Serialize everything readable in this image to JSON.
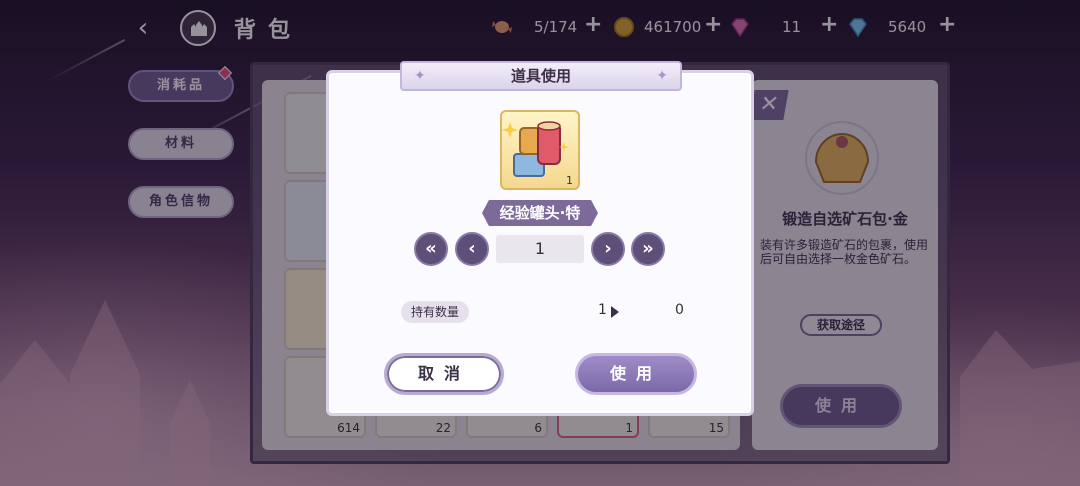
{
  "header": {
    "title": "背包",
    "resources": [
      {
        "icon": "candy-icon",
        "value": "5/174"
      },
      {
        "icon": "gold-coin-icon",
        "value": "461700"
      },
      {
        "icon": "pink-gem-icon",
        "value": "11"
      },
      {
        "icon": "blue-diamond-icon",
        "value": "5640"
      }
    ],
    "plus": "+",
    "back_glyph": "‹"
  },
  "side_tabs": [
    {
      "label": "消耗品",
      "active": true
    },
    {
      "label": "材料",
      "active": false
    },
    {
      "label": "角色信物",
      "active": false
    }
  ],
  "inventory": {
    "slot_counts": [
      "614",
      "22",
      "6",
      "1",
      "15"
    ]
  },
  "detail": {
    "close_glyph": "✕",
    "item_name": "锻造自选矿石包·金",
    "description": "装有许多锻造矿石的包裹，使用后可自由选择一枚金色矿石。",
    "source_button": "获取途径",
    "use_button": "使用"
  },
  "modal": {
    "title": "道具使用",
    "item_name": "经验罐头·特",
    "item_count": "1",
    "quantity": "1",
    "owned_label": "持有数量",
    "owned_from": "1",
    "owned_to": "0",
    "cancel_label": "取消",
    "use_label": "使用",
    "min_glyph": "«",
    "minus_glyph": "‹",
    "plus_glyph": "›",
    "max_glyph": "»",
    "star_glyph": "✦"
  },
  "colors": {
    "accent": "#7b6a9a",
    "active_tab": "#6d5b8f",
    "badge": "#e0507a"
  }
}
